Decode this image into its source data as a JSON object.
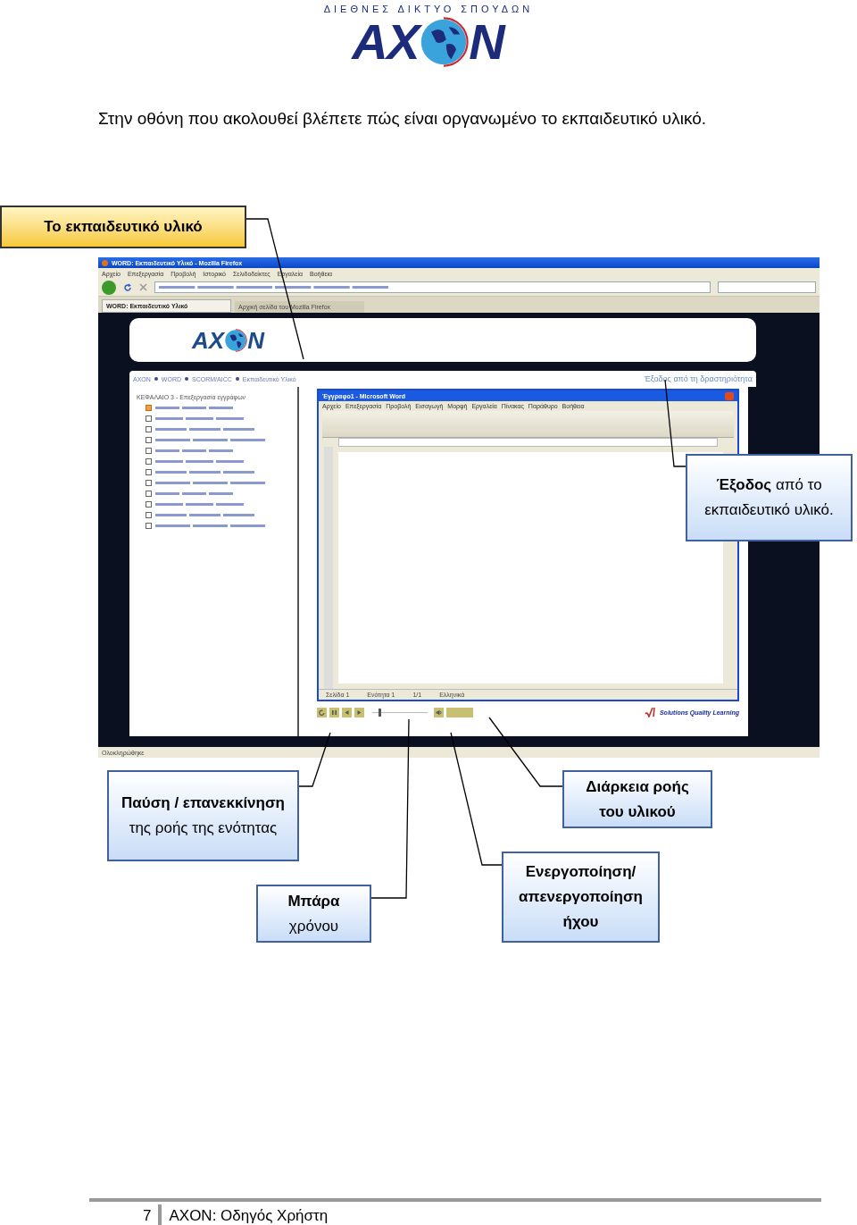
{
  "header": {
    "tagline": "ΔΙΕΘΝΕΣ ΔΙΚΤΥΟ ΣΠΟΥΔΩΝ",
    "logo_left": "AX",
    "logo_right": "N"
  },
  "intro": "Στην οθόνη που ακολουθεί βλέπετε πώς είναι οργανωμένο το εκπαιδευτικό υλικό.",
  "screenshot": {
    "browser_title": "WORD: Εκπαιδευτικό Υλικό - Mozilla Firefox",
    "browser_menu": [
      "Αρχείο",
      "Επεξεργασία",
      "Προβολή",
      "Ιστορικό",
      "Σελιδοδείκτες",
      "Εργαλεία",
      "Βοήθεια"
    ],
    "tabs": [
      {
        "label": "WORD: Εκπαιδευτικό Υλικό",
        "selected": true
      },
      {
        "label": "Αρχική σελίδα του Mozilla Firefox",
        "selected": false
      }
    ],
    "site_logo_left": "AX",
    "site_logo_right": "N",
    "breadcrumb": [
      "AXON",
      "WORD",
      "SCORM/AICC",
      "Εκπαιδευτικό Υλικό"
    ],
    "exit_link": "Έξοδος από τη δραστηριότητα",
    "chapter": "ΚΕΦΑΛΑΙΟ 3 - Επεξεργασία εγγράφων",
    "lessons": [
      {
        "checked": true
      },
      {
        "checked": false
      },
      {
        "checked": false
      },
      {
        "checked": false
      },
      {
        "checked": false
      },
      {
        "checked": false
      },
      {
        "checked": false
      },
      {
        "checked": false
      },
      {
        "checked": false
      },
      {
        "checked": false
      },
      {
        "checked": false
      },
      {
        "checked": false
      }
    ],
    "word": {
      "title": "Έγγραφο1 - Microsoft Word",
      "menu": [
        "Αρχείο",
        "Επεξεργασία",
        "Προβολή",
        "Εισαγωγή",
        "Μορφή",
        "Εργαλεία",
        "Πίνακας",
        "Παράθυρο",
        "Βοήθεια"
      ],
      "status": [
        "Σελίδα 1",
        "Ενότητα 1",
        "1/1",
        "Ελληνικά"
      ]
    },
    "player": {
      "level": 0.12
    },
    "brand": "Solutions Quality Learning",
    "status_bar": "Ολοκληρώθηκε"
  },
  "callouts": [
    {
      "kind": "yellow",
      "text": "Το εκπαιδευτικό υλικό"
    },
    {
      "kind": "blue",
      "text": "**Έξοδος** από το εκπαιδευτικό υλικό."
    },
    {
      "kind": "blue",
      "text": "**Παύση / επανεκκίνηση** της ροής της ενότητας"
    },
    {
      "kind": "blue",
      "text": "**Διάρκεια ροής του υλικού**"
    },
    {
      "kind": "blue",
      "text": "**Μπάρα** χρόνου"
    },
    {
      "kind": "blue",
      "text": "**Ενεργοποίηση/ απενεργοποίηση ήχου**"
    }
  ],
  "footer": {
    "page": "7",
    "title": "AXON: Οδηγός Χρήστη"
  }
}
